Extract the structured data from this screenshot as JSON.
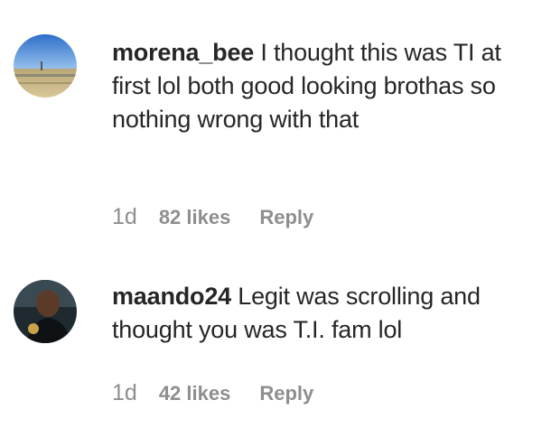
{
  "comments": [
    {
      "username": "morena_bee",
      "text": "I thought this was TI at first lol both good looking brothas so nothing wrong with that",
      "time": "1d",
      "likes": "82 likes",
      "reply_label": "Reply",
      "avatar_icon": "landscape-photo-avatar"
    },
    {
      "username": "maando24",
      "text": "Legit was scrolling and thought you was T.I. fam lol",
      "time": "1d",
      "likes": "42 likes",
      "reply_label": "Reply",
      "avatar_icon": "person-photo-avatar"
    }
  ]
}
